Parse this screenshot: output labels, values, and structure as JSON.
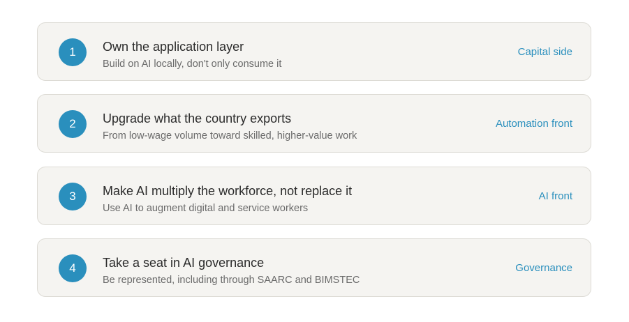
{
  "items": [
    {
      "number": "1",
      "title": "Own the application layer",
      "subtitle": "Build on AI locally, don't only consume it",
      "tag": "Capital side"
    },
    {
      "number": "2",
      "title": "Upgrade what the country exports",
      "subtitle": "From low-wage volume toward skilled, higher-value work",
      "tag": "Automation front"
    },
    {
      "number": "3",
      "title": "Make AI multiply the workforce, not replace it",
      "subtitle": "Use AI to augment digital and service workers",
      "tag": "AI front"
    },
    {
      "number": "4",
      "title": "Take a seat in AI governance",
      "subtitle": "Be represented, including through SAARC and BIMSTEC",
      "tag": "Governance"
    }
  ],
  "colors": {
    "accent": "#2a8fbd",
    "card_background": "#f5f4f1",
    "card_border": "#dddbd5",
    "title_text": "#2b2b2b",
    "subtitle_text": "#6a6a6a"
  }
}
